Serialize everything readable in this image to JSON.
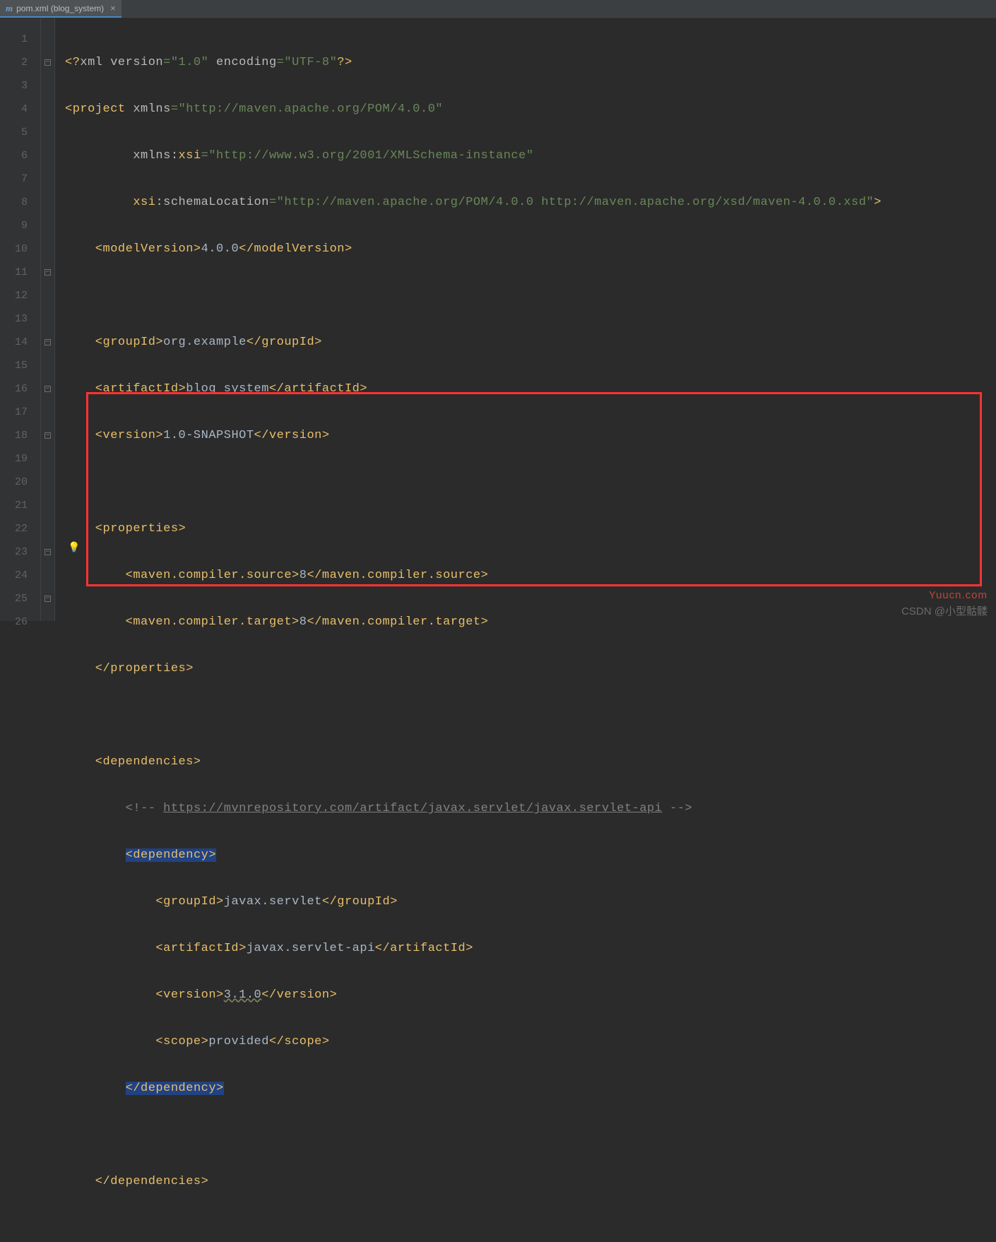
{
  "tab": {
    "icon_letter": "m",
    "label": "pom.xml (blog_system)",
    "close": "×"
  },
  "lines": [
    "1",
    "2",
    "3",
    "4",
    "5",
    "6",
    "7",
    "8",
    "9",
    "10",
    "11",
    "12",
    "13",
    "14",
    "15",
    "16",
    "17",
    "18",
    "19",
    "20",
    "21",
    "22",
    "23",
    "24",
    "25",
    "26"
  ],
  "code": {
    "l1_a": "<?",
    "l1_b": "xml version",
    "l1_c": "=\"1.0\" ",
    "l1_d": "encoding",
    "l1_e": "=\"UTF-8\"",
    "l1_f": "?>",
    "l2_a": "<project ",
    "l2_b": "xmlns",
    "l2_c": "=\"http://maven.apache.org/POM/4.0.0\"",
    "l3_a": "         ",
    "l3_b": "xmlns:",
    "l3_c": "xsi",
    "l3_d": "=\"http://www.w3.org/2001/XMLSchema-instance\"",
    "l4_a": "         ",
    "l4_b": "xsi",
    "l4_c": ":schemaLocation",
    "l4_d": "=\"http://maven.apache.org/POM/4.0.0 http://maven.apache.org/xsd/maven-4.0.0.xsd\"",
    "l4_e": ">",
    "l5_a": "    <modelVersion>",
    "l5_b": "4.0.0",
    "l5_c": "</modelVersion>",
    "l7_a": "    <groupId>",
    "l7_b": "org.example",
    "l7_c": "</groupId>",
    "l8_a": "    <artifactId>",
    "l8_b": "blog_system",
    "l8_c": "</artifactId>",
    "l9_a": "    <version>",
    "l9_b": "1.0-SNAPSHOT",
    "l9_c": "</version>",
    "l11_a": "    <properties>",
    "l12_a": "        <maven.compiler.source>",
    "l12_b": "8",
    "l12_c": "</maven.compiler.source>",
    "l13_a": "        <maven.compiler.target>",
    "l13_b": "8",
    "l13_c": "</maven.compiler.target>",
    "l14_a": "    </properties>",
    "l16_a": "    <dependencies>",
    "l17_a": "        ",
    "l17_b": "<!-- ",
    "l17_c": "https://mvnrepository.com/artifact/javax.servlet/javax.servlet-api",
    "l17_d": " -->",
    "l18_a": "        ",
    "l18_b": "<dependency>",
    "l19_a": "            <groupId>",
    "l19_b": "javax.servlet",
    "l19_c": "</groupId>",
    "l20_a": "            <artifactId>",
    "l20_b": "javax.servlet-api",
    "l20_c": "</artifactId>",
    "l21_a": "            <version>",
    "l21_b": "3.1.0",
    "l21_c": "</version>",
    "l22_a": "            <scope>",
    "l22_b": "provided",
    "l22_c": "</scope>",
    "l23_a": "        ",
    "l23_b": "</dependency>",
    "l25_a": "    </dependencies>"
  },
  "watermark1": "Yuucn.com",
  "watermark2": "CSDN @小型骷髅"
}
